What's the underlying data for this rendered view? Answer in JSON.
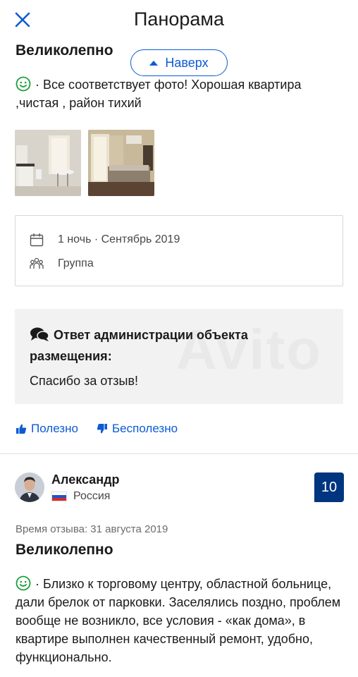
{
  "header": {
    "title": "Панорама"
  },
  "back_to_top": {
    "label": "Наверх"
  },
  "review1": {
    "title": "Великолепно",
    "text": "· Все соответствует фото! Хорошая квартира ,чистая , район тихий",
    "stay_info": "1 ночь · Сентябрь 2019",
    "traveler_type": "Группа",
    "admin_response": {
      "heading": "Ответ администрации объекта размещения:",
      "text": "Спасибо за отзыв!"
    }
  },
  "watermark": "Avito",
  "votes": {
    "helpful": "Полезно",
    "not_helpful": "Бесполезно"
  },
  "review2": {
    "author": "Александр",
    "country": "Россия",
    "score": "10",
    "date": "Время отзыва: 31 августа 2019",
    "title": "Великолепно",
    "text": "· Близко к торговому центру, областной больнице, дали брелок от парковки. Заселялись поздно, проблем вообще не возникло, все условия - «как дома», в квартире выполнен качественный ремонт, удобно, функционально."
  },
  "colors": {
    "accent": "#0b5bd3",
    "score_bg": "#003580",
    "smile": "#1a9f3c"
  }
}
